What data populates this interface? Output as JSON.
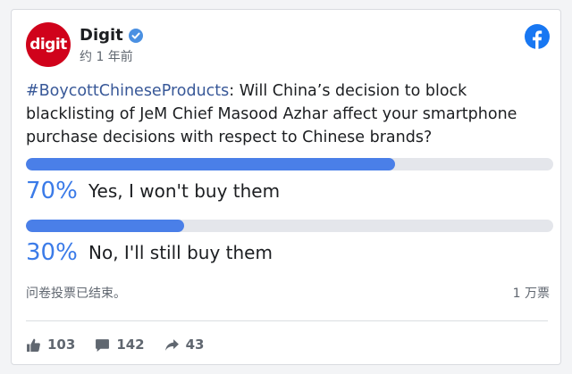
{
  "post": {
    "author": "Digit",
    "avatar_text": "digit",
    "timestamp": "约 1 年前",
    "hashtag": "#BoycottChineseProducts",
    "text": ": Will China’s decision to block blacklisting of JeM Chief Masood Azhar affect your smartphone purchase decisions with respect to Chinese brands?"
  },
  "poll": {
    "options": [
      {
        "percent": "70%",
        "value": 70,
        "label": "Yes, I won't buy them"
      },
      {
        "percent": "30%",
        "value": 30,
        "label": "No, I'll still buy them"
      }
    ],
    "status": "问卷投票已结束。",
    "vote_count": "1 万票"
  },
  "actions": {
    "likes": "103",
    "comments": "142",
    "shares": "43"
  },
  "colors": {
    "accent": "#3b7be8",
    "bar_fill": "#4a7fe8",
    "brand_red": "#d0021b",
    "facebook_blue": "#1877f2"
  },
  "icons": [
    "verified-badge-icon",
    "facebook-icon",
    "like-icon",
    "comment-icon",
    "share-icon"
  ]
}
